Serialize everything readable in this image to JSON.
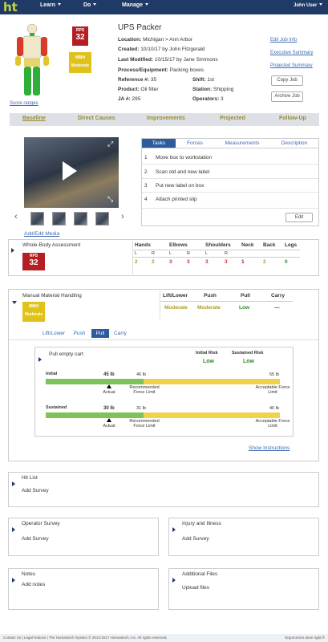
{
  "nav": {
    "logo": "ht",
    "menus": [
      "Learn",
      "Do",
      "Manage"
    ],
    "user": "John User"
  },
  "job": {
    "title": "UPS Packer",
    "location_label": "Location:",
    "location": "Michigan > Ann Arbor",
    "created_label": "Created:",
    "created": "10/10/17 by John Fitzgerald",
    "modified_label": "Last Modified:",
    "modified": "10/15/17 by Jane Simmons",
    "process_label": "Process/Equipment:",
    "process": "Packing boxes",
    "reference_label": "Reference #:",
    "reference": "35",
    "shift_label": "Shift:",
    "shift": "1st",
    "product_label": "Product:",
    "product": "Oil filter",
    "station_label": "Station:",
    "station": "Shipping",
    "ja_label": "JA #:",
    "ja": "295",
    "operators_label": "Operators:",
    "operators": "3",
    "score_ranges": "Score ranges"
  },
  "badges": {
    "rps_label": "RPS",
    "rps_value": "32",
    "mmh_label": "MMH",
    "mmh_value": "Moderate"
  },
  "actions": {
    "edit_job": "Edit Job Info",
    "exec_summary": "Executive Summary",
    "projected_summary": "Projected Summary",
    "copy_job": "Copy Job",
    "archive_job": "Archive Job"
  },
  "steps": [
    "Baseline",
    "Direct Causes",
    "Improvements",
    "Projected",
    "Follow-Up"
  ],
  "media": {
    "add_edit": "Add/Edit Media"
  },
  "tabs": [
    "Tasks",
    "Forces",
    "Measurements",
    "Description"
  ],
  "tasks": [
    {
      "n": "1",
      "text": "Move box to workstation"
    },
    {
      "n": "2",
      "text": "Scan old and new label"
    },
    {
      "n": "3",
      "text": "Put new label on box"
    },
    {
      "n": "4",
      "text": "Attach printed slip"
    }
  ],
  "tasks_edit": "Edit",
  "wba": {
    "title": "Whole-Body Assessment",
    "rps_label": "RPS",
    "rps_value": "32",
    "columns": [
      {
        "name": "Hands",
        "sides": [
          "L",
          "R"
        ],
        "values": [
          "2",
          "2"
        ],
        "colors": [
          "olive",
          "olive"
        ]
      },
      {
        "name": "Elbows",
        "sides": [
          "L",
          "R"
        ],
        "values": [
          "3",
          "3"
        ],
        "colors": [
          "red",
          "red"
        ]
      },
      {
        "name": "Shoulders",
        "sides": [
          "L",
          "R"
        ],
        "values": [
          "3",
          "3"
        ],
        "colors": [
          "red",
          "red"
        ]
      },
      {
        "name": "Neck",
        "sides": [],
        "values": [
          "1"
        ],
        "colors": [
          "darkred"
        ]
      },
      {
        "name": "Back",
        "sides": [],
        "values": [
          "2"
        ],
        "colors": [
          "olive"
        ]
      },
      {
        "name": "Legs",
        "sides": [],
        "values": [
          "0"
        ],
        "colors": [
          "green"
        ]
      }
    ]
  },
  "mmh": {
    "title": "Manual Material Handling",
    "badge_label": "MMH",
    "badge_value": "Moderate",
    "columns": [
      "Lift/Lower",
      "Push",
      "Pull",
      "Carry"
    ],
    "values": [
      "Moderate",
      "Moderate",
      "Low",
      "—"
    ],
    "tabs": [
      "Lift/Lower",
      "Push",
      "Pull",
      "Carry"
    ],
    "active_tab": "Pull"
  },
  "pull": {
    "title": "Pull empty cart",
    "initial_risk_label": "Initial Risk",
    "initial_risk": "Low",
    "sustained_risk_label": "Sustained Risk",
    "sustained_risk": "Low",
    "initial": {
      "label": "Initial",
      "actual": "45 lb",
      "recommended": "46 lb",
      "acceptable": "55 lb"
    },
    "sustained": {
      "label": "Sustained",
      "actual": "30 lb",
      "recommended": "31 lb",
      "acceptable": "40 lb"
    },
    "actual_caption": "Actual",
    "recommended_caption": "Recommended Force Limit",
    "acceptable_caption": "Acceptable Force Limit",
    "show_instructions": "Show Instructions"
  },
  "sections": {
    "hit_list": "Hit List",
    "hit_list_action": "Add Survey",
    "operator_survey": "Operator Survey",
    "operator_action": "Add Survey",
    "injury": "Injury and Illness",
    "injury_action": "Add Survey",
    "notes": "Notes",
    "notes_action": "Add notes",
    "files": "Additional Files",
    "files_action": "Upload files"
  },
  "footer": {
    "left": "Contact Us | Legal Notices | The Humantech System © 2013-2017 Humantech, Inc. All rights reserved.",
    "right": "Ergonomics done right.®"
  },
  "colors": {
    "nav": "#1f3a66",
    "rps": "#b51f24",
    "mmh": "#e0c21a",
    "green": "#7dc25a",
    "yellow": "#f0d34a"
  }
}
